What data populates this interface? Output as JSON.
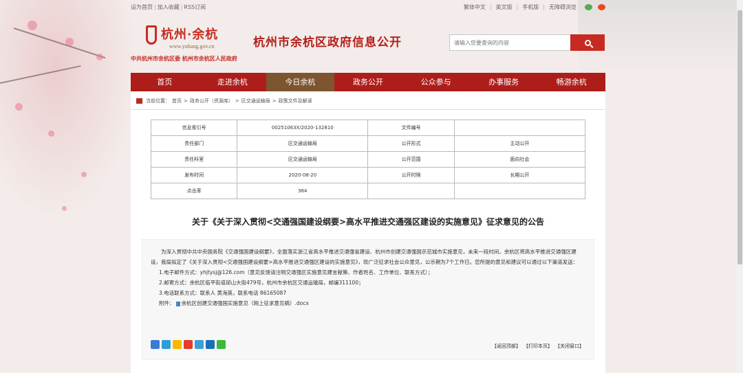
{
  "topbar": {
    "left": [
      "设为首页",
      "加入收藏",
      "RSS订阅"
    ],
    "right": [
      "繁体中文",
      "英文版",
      "手机版",
      "无障碍浏览"
    ],
    "wechat_icon": "wechat-icon",
    "weibo_icon": "weibo-icon"
  },
  "header": {
    "logo_text": "杭州·余杭",
    "logo_url": "www.yuhang.gov.cn",
    "title": "杭州市余杭区政府信息公开",
    "sub": "中共杭州市余杭区委  杭州市余杭区人民政府",
    "search_placeholder": "请输入您要查询的内容"
  },
  "nav": {
    "items": [
      "首页",
      "走进余杭",
      "今日余杭",
      "政务公开",
      "公众参与",
      "办事服务",
      "畅游余杭"
    ],
    "active_index": 2
  },
  "breadcrumb": {
    "label": "当前位置：",
    "path": [
      "首页",
      "政务公开（资源库）",
      "区交通运输局",
      "政策文件及解读"
    ]
  },
  "info": {
    "rows": [
      [
        "信息索引号",
        "00251063X/2020-132810",
        "文件编号",
        ""
      ],
      [
        "责任部门",
        "区交通运输局",
        "公开形式",
        "主动公开"
      ],
      [
        "责任科室",
        "区交通运输局",
        "公开范围",
        "面向社会"
      ],
      [
        "发布时间",
        "2020-08-20",
        "公开时限",
        "长期公开"
      ],
      [
        "点击率",
        "364",
        "",
        ""
      ]
    ]
  },
  "doc": {
    "title": "关于《关于深入贯彻<交通强国建设纲要>高水平推进交通强区建设的实施意见》征求意见的公告",
    "intro": "为深入贯彻中共中央国务院《交通强国建设纲要》，全面落实浙江省高水平推进交通强省建设、杭州市创建交通强国示范城市实施意见，未来一段时间，余杭区将高水平推进交通强区建设，我局拟定了《关于深入贯彻<交通强国建设纲要>高水平推进交通强区建设的实施意见》，现广泛征求社会公众意见，公示期为7个工作日。您所提的意见和建议可以通过以下渠道发送：",
    "items": [
      "1.电子邮件方式：yhjtysj@126.com（意见反馈请注明交通强区实施意见建言献策、作者姓名、工作单位、联系方式）；",
      "2.邮寄方式：余杭区临平街道邱山大街479号，杭州市余杭区交通运输局，邮编311100；",
      "3.电话联系方式：联系人 黄海英，联系电话 86165087"
    ],
    "attach_label": "附件：",
    "attach_name": "余杭区创建交通强国实施意见（网上征求意见稿）.docx"
  },
  "actions": [
    "【返回顶部】",
    "【打印本页】",
    "【关闭窗口】"
  ],
  "share_icons": [
    "share-plus-icon",
    "qq-icon",
    "qzone-icon",
    "weibo-icon",
    "tencent-weibo-icon",
    "renren-icon",
    "wechat-icon"
  ],
  "colors": {
    "brand_red": "#ad1e1a",
    "active_nav": "#7d5530"
  }
}
